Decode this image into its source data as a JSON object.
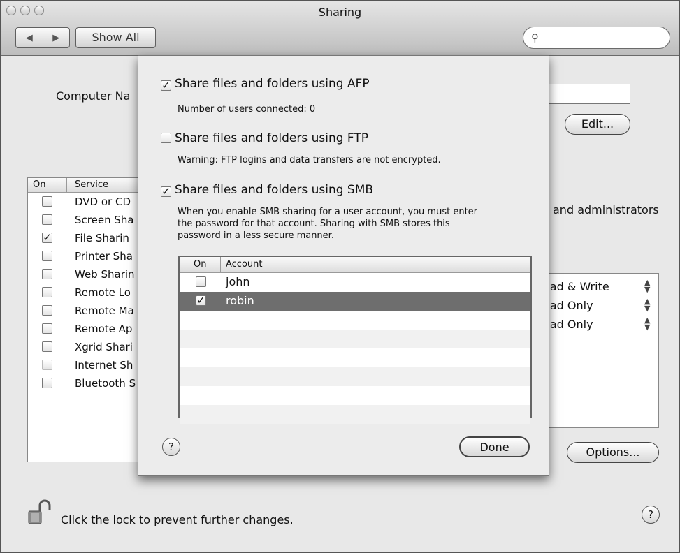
{
  "window": {
    "title": "Sharing"
  },
  "toolbar": {
    "back": "◀",
    "forward": "▶",
    "show_all": "Show All",
    "search_placeholder": ""
  },
  "computer_name": {
    "label": "Computer Na",
    "edit_label": "Edit..."
  },
  "services": {
    "col_on": "On",
    "col_service": "Service",
    "items": [
      {
        "label": "DVD or CD",
        "checked": false
      },
      {
        "label": "Screen Sha",
        "checked": false
      },
      {
        "label": "File Sharin",
        "checked": true
      },
      {
        "label": "Printer Sha",
        "checked": false
      },
      {
        "label": "Web Sharin",
        "checked": false
      },
      {
        "label": "Remote Lo",
        "checked": false
      },
      {
        "label": "Remote Ma",
        "checked": false
      },
      {
        "label": "Remote Ap",
        "checked": false
      },
      {
        "label": "Xgrid Shari",
        "checked": false
      },
      {
        "label": "Internet Sh",
        "checked": false
      },
      {
        "label": "Bluetooth S",
        "checked": false
      }
    ]
  },
  "background": {
    "admins_text": "and administrators"
  },
  "permissions": [
    "ead & Write",
    "ead Only",
    "ead Only"
  ],
  "sheet": {
    "afp": {
      "label": "Share files and folders using AFP",
      "checked": true,
      "desc": "Number of users connected: 0"
    },
    "ftp": {
      "label": "Share files and folders using FTP",
      "checked": false,
      "desc": "Warning: FTP logins and data transfers are not encrypted."
    },
    "smb": {
      "label": "Share files and folders using SMB",
      "checked": true,
      "desc_lines": [
        "When you enable SMB sharing for a user account, you must enter",
        "the password for that account. Sharing with SMB stores this",
        "password in a less secure manner."
      ]
    },
    "accounts": {
      "col_on": "On",
      "col_account": "Account",
      "rows": [
        {
          "name": "john",
          "checked": false
        },
        {
          "name": "robin",
          "checked": true
        }
      ]
    },
    "help": "?",
    "done": "Done"
  },
  "options_label": "Options...",
  "footer": {
    "lock_text": "Click the lock to prevent further changes.",
    "help": "?"
  }
}
